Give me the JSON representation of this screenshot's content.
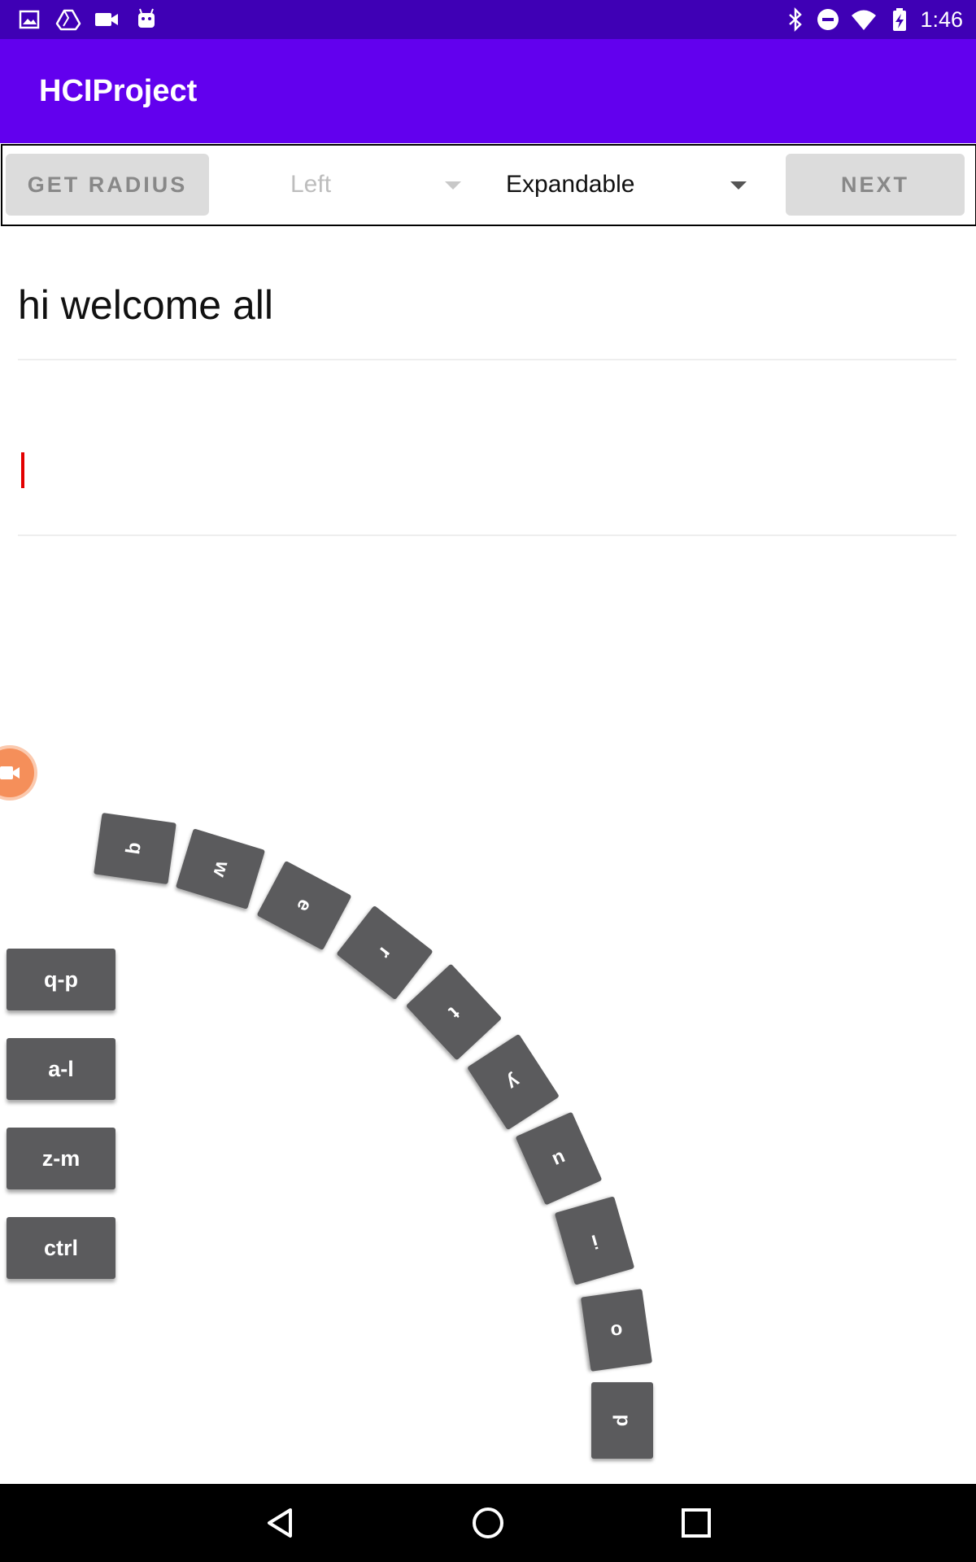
{
  "status_bar": {
    "time": "1:46",
    "left_icons": [
      "gallery-icon",
      "drive-icon",
      "video-icon",
      "android-icon"
    ],
    "right_icons": [
      "bluetooth-icon",
      "do-not-disturb-icon",
      "wifi-icon",
      "battery-charging-icon"
    ]
  },
  "app_bar": {
    "title": "HCIProject"
  },
  "toolbar": {
    "get_radius_label": "GET RADIUS",
    "side_spinner_value": "Left",
    "mode_spinner_value": "Expandable",
    "next_label": "NEXT"
  },
  "main": {
    "display_text": "hi welcome all",
    "input_value": ""
  },
  "keyboard": {
    "arc_keys": [
      "q",
      "w",
      "e",
      "r",
      "t",
      "y",
      "u",
      "i",
      "o",
      "p"
    ],
    "side_keys": [
      "q-p",
      "a-l",
      "z-m",
      "ctrl"
    ]
  },
  "colors": {
    "status_bar": "#3f00b5",
    "app_bar": "#6200ee",
    "key": "#5b5b5d",
    "cursor": "#e30000",
    "fab": "#f58f5a"
  },
  "nav_bar": {
    "icons": [
      "back-icon",
      "home-icon",
      "recents-icon"
    ]
  }
}
